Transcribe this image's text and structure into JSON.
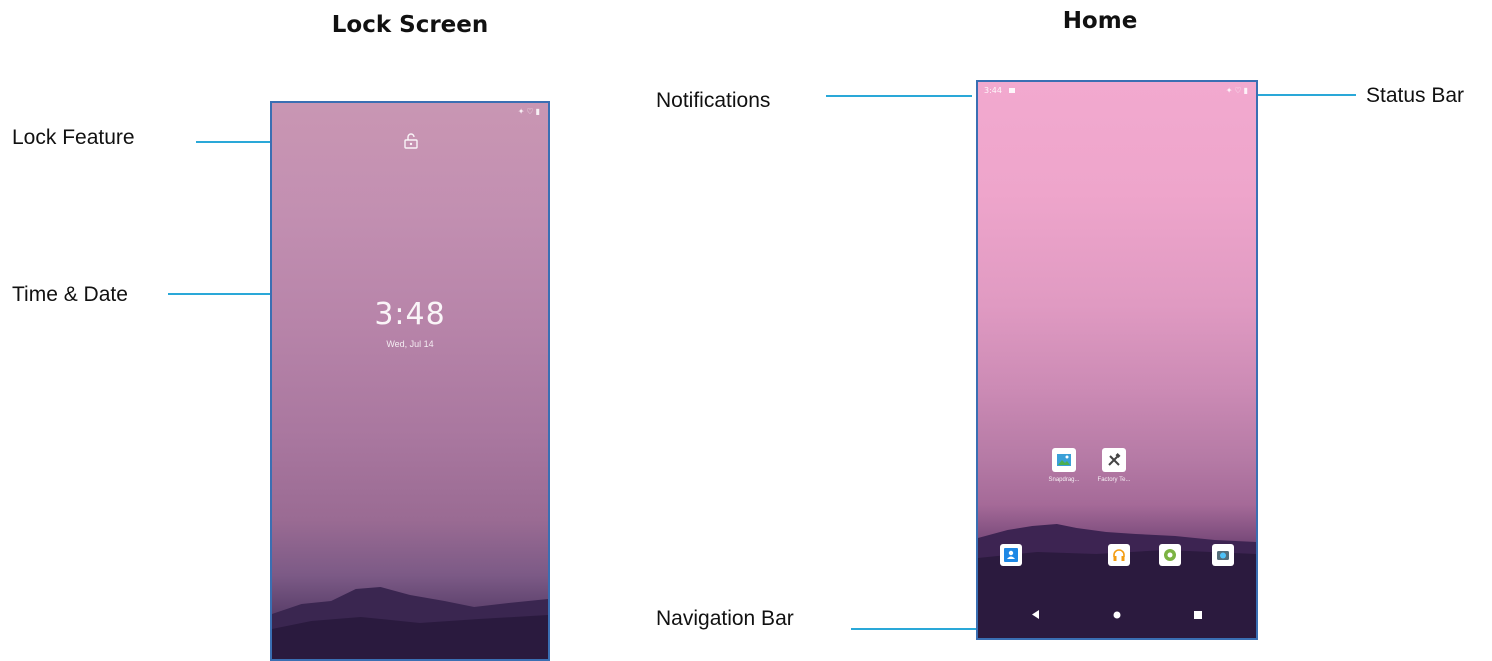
{
  "headings": {
    "lock_screen": "Lock Screen",
    "home": "Home"
  },
  "callouts": {
    "lock_feature": "Lock Feature",
    "time_date": "Time & Date",
    "notifications": "Notifications",
    "status_bar": "Status Bar",
    "navigation_bar": "Navigation Bar"
  },
  "lock_screen": {
    "time": "3:48",
    "date": "Wed, Jul 14",
    "icons": [
      "lock-open-icon",
      "vibrate-icon",
      "wifi-icon",
      "battery-icon"
    ]
  },
  "home_screen": {
    "status_time": "3:44",
    "apps": [
      {
        "label": "Snapdrag...",
        "icon": "gallery-icon"
      },
      {
        "label": "Factory Te...",
        "icon": "tools-icon"
      }
    ],
    "dock": [
      "contacts-icon",
      "headphones-icon",
      "android-icon",
      "camera-icon"
    ],
    "nav": [
      "back-icon",
      "home-icon",
      "recents-icon"
    ]
  },
  "colors": {
    "leader_line": "#2aa8d8",
    "phone_border": "#3a6fb3"
  }
}
